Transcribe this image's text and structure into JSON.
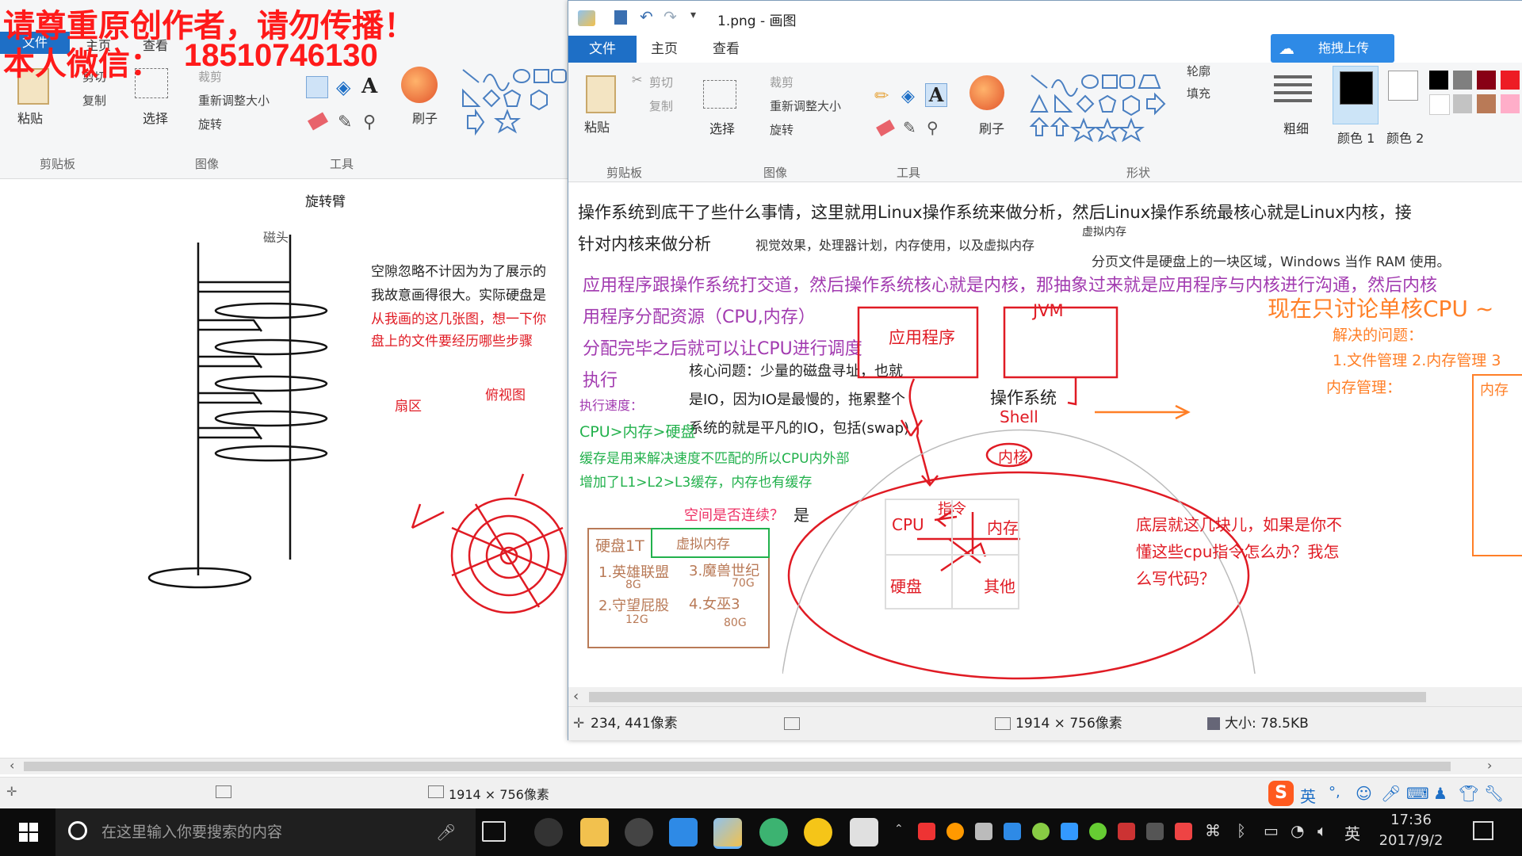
{
  "watermark": {
    "line1": "请尊重原创作者，请勿传播！",
    "line2_prefix": "本人微信：",
    "line2_number": "18510746130"
  },
  "bg_window": {
    "tabs": [
      "文件",
      "主页",
      "查看"
    ],
    "clipboard": {
      "paste": "粘贴",
      "cut": "剪切",
      "copy": "复制",
      "group": "剪贴板"
    },
    "image": {
      "select": "选择",
      "crop": "裁剪",
      "resize": "重新调整大小",
      "rotate": "旋转",
      "group": "图像"
    },
    "tools": {
      "group": "工具",
      "brush": "刷子"
    },
    "status_size": "1914 × 756像素",
    "drawing": {
      "arm_label": "旋转臂",
      "head_label": "磁头",
      "note1": "空隙忽略不计因为为了展示的",
      "note2": "我故意画得很大。实际硬盘是",
      "note3": "从我画的这几张图，想一下你",
      "note4": "盘上的文件要经历哪些步骤",
      "sector_label": "扇区",
      "topview_label": "俯视图"
    }
  },
  "front_window": {
    "title": "1.png - 画图",
    "tabs": [
      "文件",
      "主页",
      "查看"
    ],
    "upload_button": "拖拽上传",
    "clipboard": {
      "paste": "粘贴",
      "cut": "剪切",
      "copy": "复制",
      "group": "剪贴板"
    },
    "image": {
      "select": "选择",
      "crop": "裁剪",
      "resize": "重新调整大小",
      "rotate": "旋转",
      "group": "图像"
    },
    "tools": {
      "group": "工具",
      "brush": "刷子"
    },
    "shapes": {
      "outline": "轮廓",
      "fill": "填充",
      "group": "形状"
    },
    "size_label": "粗细",
    "color1": "颜色 1",
    "color2": "颜色 2",
    "status": {
      "cursor": "234, 441像素",
      "dims": "1914 × 756像素",
      "filesize": "大小: 78.5KB"
    },
    "canvas": {
      "line1": "操作系统到底干了些什么事情，这里就用Linux操作系统来做分析，然后Linux操作系统最核心就是Linux内核，接",
      "line2": "针对内核来做分析",
      "line2_note": "视觉效果，处理器计划，内存使用，以及虚拟内存",
      "vm_label": "虚拟内存",
      "paging_note": "分页文件是硬盘上的一块区域，Windows 当作 RAM 使用。",
      "p1": "应用程序跟操作系统打交道，然后操作系统核心就是内核，那抽象过来就是应用程序与内核进行沟通，然后内核",
      "p2": "用程序分配资源（CPU,内存）",
      "p3": "分配完毕之后就可以让CPU进行调度",
      "p4": "执行",
      "speed": "执行速度：",
      "core1": "核心问题：少量的磁盘寻址，也就",
      "core2": "是IO，因为IO是最慢的，拖累整个",
      "core3": "系统的就是平凡的IO，包括(swap)",
      "g1": "CPU>内存>硬盘",
      "g2": "缓存是用来解决速度不匹配的所以CPU内外部",
      "g3": "增加了L1>L2>L3缓存，内存也有缓存",
      "contig": "空间是否连续？",
      "yes": "是",
      "disk_title": "硬盘1T",
      "vm_box": "虚拟内存",
      "game1": "1.英雄联盟",
      "game1_size": "8G",
      "game2": "2.守望屁股",
      "game2_size": "12G",
      "game3": "3.魔兽世纪",
      "game3_size": "70G",
      "game4": "4.女巫3",
      "game4_size": "80G",
      "app_box": "应用程序",
      "jvm_box": "JVM",
      "os_label": "操作系统",
      "shell_label": "Shell",
      "kernel_label": "内核",
      "cpu": "CPU",
      "instr": "指令",
      "mem": "内存",
      "disk": "硬盘",
      "other": "其他",
      "bottom1": "底层就这几块儿，如果是你不",
      "bottom2": "懂这些cpu指令怎么办？我怎",
      "bottom3": "么写代码？",
      "single_core": "现在只讨论单核CPU ~",
      "problem": "解决的问题：",
      "mgmt": "1.文件管理 2.内存管理 3",
      "mem_mgmt": "内存管理：",
      "mem_cut": "内存"
    }
  },
  "bg_status_size": "1914 × 756像素",
  "taskbar": {
    "search_placeholder": "在这里输入你要搜索的内容",
    "time": "17:36",
    "date": "2017/9/2",
    "lang": "英"
  },
  "ime": {
    "lang": "英"
  },
  "colors": {
    "accent": "#1e6fc6",
    "red": "#e01b24",
    "purple": "#a23bb0",
    "green": "#22b14c",
    "orange": "#ff7f27",
    "taskbar": "#0c0c0c"
  }
}
